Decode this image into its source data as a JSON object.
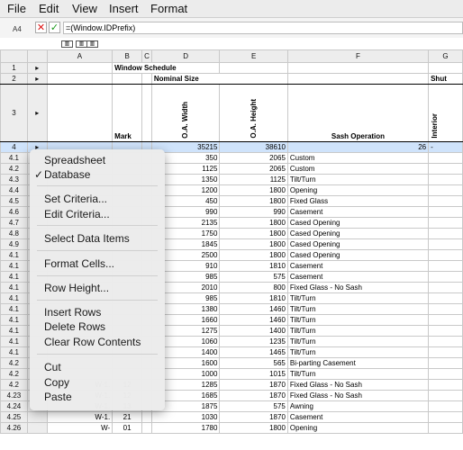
{
  "menubar": {
    "items": [
      "File",
      "Edit",
      "View",
      "Insert",
      "Format"
    ]
  },
  "formula": {
    "cell_ref": "A4",
    "cancel_icon": "✕",
    "accept_icon": "✓",
    "value": "=(Window.IDPrefix)"
  },
  "columns": [
    "A",
    "B",
    "C",
    "D",
    "E",
    "F",
    "G"
  ],
  "title_row": {
    "row": "1",
    "text": "Window Schedule"
  },
  "header_row2": {
    "row": "2",
    "nominal": "Nominal Size",
    "shutter": "Shut"
  },
  "header_row3": {
    "row": "3",
    "mark": "Mark",
    "width": "O.A. Width",
    "height": "O.A. Height",
    "sash": "Sash Operation",
    "interior": "Interior"
  },
  "selected_row": {
    "row": "4",
    "d": "35215",
    "e": "38610",
    "f": "26",
    "g": "-"
  },
  "rows": [
    {
      "row": "4.1",
      "d": "350",
      "e": "2065",
      "f": "Custom"
    },
    {
      "row": "4.2",
      "d": "1125",
      "e": "2065",
      "f": "Custom"
    },
    {
      "row": "4.3",
      "d": "1350",
      "e": "1125",
      "f": "Tilt/Turn"
    },
    {
      "row": "4.4",
      "d": "1200",
      "e": "1800",
      "f": "Opening"
    },
    {
      "row": "4.5",
      "d": "450",
      "e": "1800",
      "f": "Fixed Glass"
    },
    {
      "row": "4.6",
      "d": "990",
      "e": "990",
      "f": "Casement"
    },
    {
      "row": "4.7",
      "d": "2135",
      "e": "1800",
      "f": "Cased Opening"
    },
    {
      "row": "4.8",
      "d": "1750",
      "e": "1800",
      "f": "Cased Opening"
    },
    {
      "row": "4.9",
      "d": "1845",
      "e": "1800",
      "f": "Cased Opening"
    },
    {
      "row": "4.1",
      "d": "2500",
      "e": "1800",
      "f": "Cased Opening"
    },
    {
      "row": "4.1",
      "d": "910",
      "e": "1810",
      "f": "Casement"
    },
    {
      "row": "4.1",
      "d": "985",
      "e": "575",
      "f": "Casement"
    },
    {
      "row": "4.1",
      "d": "2010",
      "e": "800",
      "f": "Fixed Glass - No Sash"
    },
    {
      "row": "4.1",
      "d": "985",
      "e": "1810",
      "f": "Tilt/Turn"
    },
    {
      "row": "4.1",
      "d": "1380",
      "e": "1460",
      "f": "Tilt/Turn"
    },
    {
      "row": "4.1",
      "d": "1660",
      "e": "1460",
      "f": "Tilt/Turn"
    },
    {
      "row": "4.1",
      "d": "1275",
      "e": "1400",
      "f": "Tilt/Turn"
    },
    {
      "row": "4.1",
      "d": "1060",
      "e": "1235",
      "f": "Tilt/Turn"
    },
    {
      "row": "4.1",
      "d": "1400",
      "e": "1465",
      "f": "Tilt/Turn"
    },
    {
      "row": "4.2",
      "d": "1600",
      "e": "565",
      "f": "Bi-parting Casement"
    },
    {
      "row": "4.2",
      "d": "1000",
      "e": "1015",
      "f": "Tilt/Turn"
    },
    {
      "row": "4.2",
      "a": "W-1.",
      "b": "12",
      "d": "1285",
      "e": "1870",
      "f": "Fixed Glass - No Sash"
    },
    {
      "row": "4.23",
      "a": "W-1.",
      "b": "12",
      "d": "1685",
      "e": "1870",
      "f": "Fixed Glass - No Sash"
    },
    {
      "row": "4.24",
      "a": "W-1.",
      "b": "13",
      "d": "1875",
      "e": "575",
      "f": "Awning"
    },
    {
      "row": "4.25",
      "a": "W-1.",
      "b": "21",
      "d": "1030",
      "e": "1870",
      "f": "Casement"
    },
    {
      "row": "4.26",
      "a": "W-",
      "b": "01",
      "d": "1780",
      "e": "1800",
      "f": "Opening"
    }
  ],
  "context_menu": {
    "spreadsheet": "Spreadsheet",
    "database": "Database",
    "check": "✓",
    "set_criteria": "Set Criteria...",
    "edit_criteria": "Edit Criteria...",
    "select_data": "Select Data Items",
    "format_cells": "Format Cells...",
    "row_height": "Row Height...",
    "insert_rows": "Insert Rows",
    "delete_rows": "Delete Rows",
    "clear_rows": "Clear Row Contents",
    "cut": "Cut",
    "copy": "Copy",
    "paste": "Paste"
  }
}
